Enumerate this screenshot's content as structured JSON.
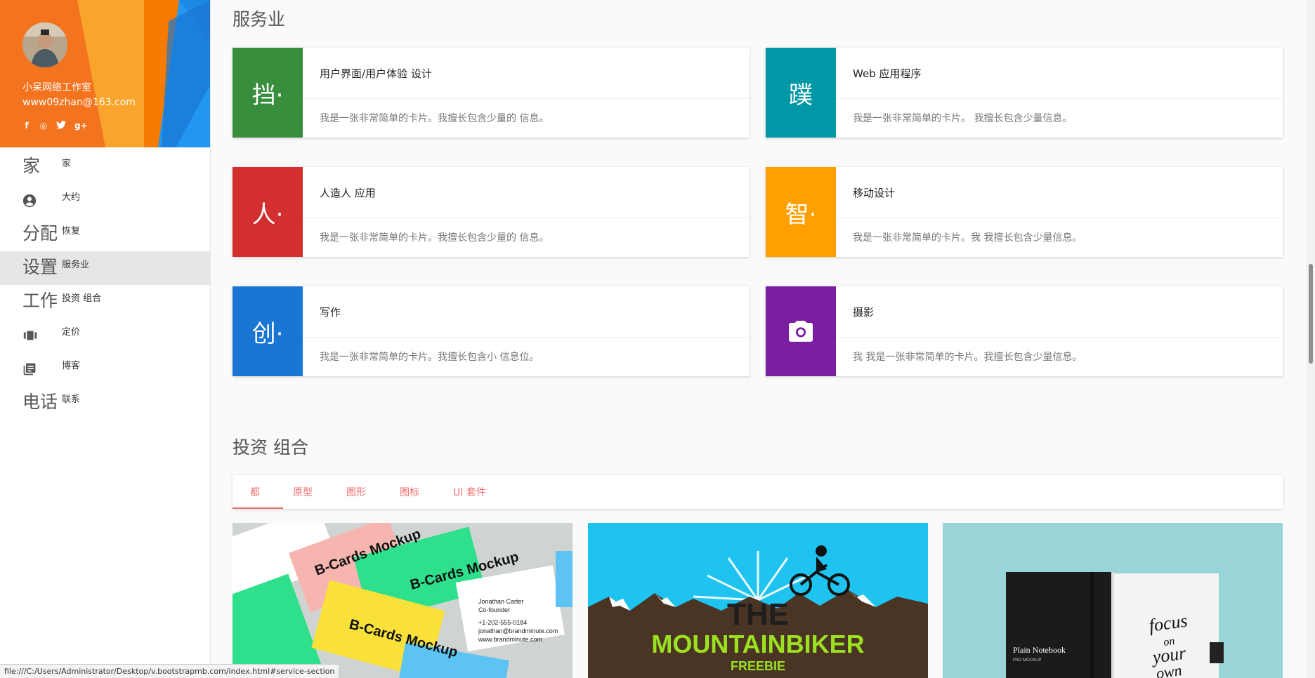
{
  "profile": {
    "name": "小呆网络工作室",
    "email": "www09zhan@163.com",
    "social": [
      "f",
      "◎",
      "t",
      "g+"
    ]
  },
  "nav": [
    {
      "icon_text": "家",
      "label": "家"
    },
    {
      "icon": "account-circle-icon",
      "label": "大约"
    },
    {
      "icon_text": "分配",
      "label": "恢复"
    },
    {
      "icon_text": "设置",
      "label": "服务业",
      "active": true
    },
    {
      "icon_text": "工作",
      "label": "投资 组合"
    },
    {
      "icon": "view-carousel-icon",
      "label": "定价"
    },
    {
      "icon": "library-books-icon",
      "label": "博客"
    },
    {
      "icon_text": "电话",
      "label": "联系"
    }
  ],
  "services": {
    "title": "服务业",
    "cards": [
      {
        "icon_text": "挡·",
        "color": "#388e3c",
        "title": "用户界面/用户体验 设计",
        "text": "我是一张非常简单的卡片。我擅长包含少量的 信息。"
      },
      {
        "icon_text": "蹼",
        "color": "#0097a7",
        "title": "Web 应用程序",
        "text": "我是一张非常简单的卡片。 我擅长包含少量信息。"
      },
      {
        "icon_text": "人·",
        "color": "#d32f2f",
        "title": "人造人 应用",
        "text": "我是一张非常简单的卡片。我擅长包含少量的 信息。"
      },
      {
        "icon_text": "智·",
        "color": "#ffa000",
        "title": "移动设计",
        "text": "我是一张非常简单的卡片。我 我擅长包含少量信息。"
      },
      {
        "icon_text": "创·",
        "color": "#1976d2",
        "title": "写作",
        "text": "我是一张非常简单的卡片。我擅长包含小 信息位。"
      },
      {
        "icon": "camera-icon",
        "color": "#7b1fa2",
        "title": "摄影",
        "text": "我 我是一张非常简单的卡片。我擅长包含少量信息。"
      }
    ]
  },
  "portfolio": {
    "title": "投资 组合",
    "tabs": [
      "都",
      "原型",
      "图形",
      "图标",
      "UI 套件"
    ],
    "active_tab": "都",
    "items": [
      {
        "image": "business-cards-mockup",
        "texts": [
          "B-Cards Mockup",
          "Jonathan Carter",
          "Co-founder",
          "+1-202-555-0184",
          "jonathan@brandminute.com",
          "www.brandminute.com"
        ]
      },
      {
        "image": "mountain-biker-poster",
        "texts": [
          "THE",
          "MOUNTAINBIKER",
          "FREEBIE"
        ]
      },
      {
        "image": "notebook-mockup",
        "texts": [
          "Plain Notebook",
          "PSD MOCKUP",
          "focus",
          "on",
          "your",
          "own"
        ]
      }
    ]
  },
  "status_bar": "file:///C:/Users/Administrator/Desktop/v.bootstrapmb.com/index.html#service-section",
  "colors": {
    "accent": "#f26d6d",
    "sidebar_active": "#e6e6e6"
  }
}
